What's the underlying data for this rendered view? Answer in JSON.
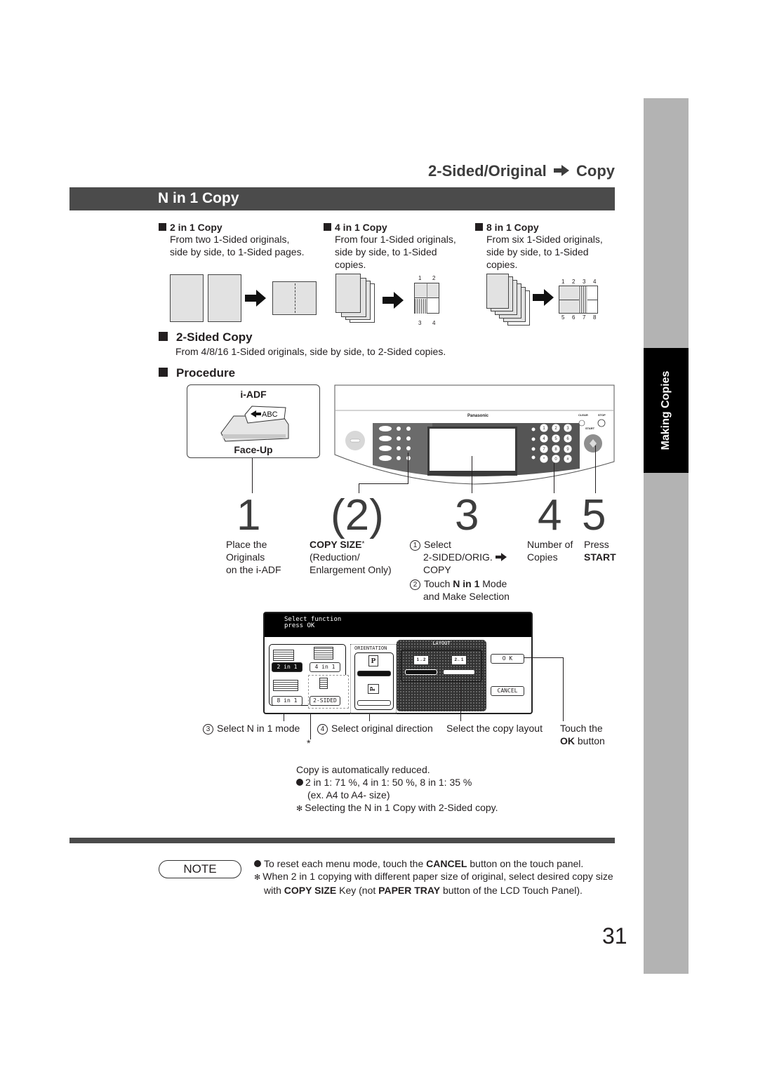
{
  "side_tab": {
    "label": "Making Copies"
  },
  "section_title": {
    "left": "2-Sided/Original",
    "arrow_icon": "right-arrow-icon",
    "right": "Copy"
  },
  "title_bar": {
    "text": "N in 1 Copy"
  },
  "modes": [
    {
      "heading": "2 in 1 Copy",
      "desc": [
        "From two 1-Sided originals,",
        "side by side, to 1-Sided pages."
      ]
    },
    {
      "heading": "4 in 1 Copy",
      "desc": [
        "From four 1-Sided originals,",
        "side by side, to 1-Sided",
        "copies."
      ],
      "page_labels": [
        "1",
        "2",
        "3",
        "4"
      ]
    },
    {
      "heading": "8 in 1 Copy",
      "desc": [
        "From six 1-Sided originals,",
        "side by side, to 1-Sided",
        "copies."
      ],
      "page_labels": [
        "1",
        "2",
        "3",
        "4",
        "5",
        "6",
        "7",
        "8"
      ]
    }
  ],
  "two_sided": {
    "heading": "2-Sided Copy",
    "desc": "From  4/8/16 1-Sided originals, side by side, to 2-Sided copies."
  },
  "procedure": {
    "heading": "Procedure",
    "adf": {
      "title": "i-ADF",
      "label": "ABC",
      "footer": "Face-Up"
    },
    "panel": {
      "brand": "Panasonic",
      "clear": "CLEAR",
      "stop": "STOP",
      "start": "START",
      "keys": [
        "1",
        "2",
        "3",
        "4",
        "5",
        "6",
        "7",
        "8",
        "9",
        "*",
        "0",
        "#"
      ]
    },
    "steps": [
      {
        "num": "1",
        "lines": [
          "Place the",
          "Originals",
          "on the i-ADF"
        ]
      },
      {
        "num": "(2)",
        "bold": "COPY SIZE",
        "star": "*",
        "lines": [
          "(Reduction/",
          "Enlargement Only)"
        ]
      },
      {
        "num": "3",
        "sub1": {
          "marker": "1",
          "lines": [
            "Select",
            "2-SIDED/ORIG.",
            "COPY"
          ]
        },
        "sub2": {
          "marker": "2",
          "pre": "Touch ",
          "bold": "N in 1",
          "post": " Mode",
          "line2": "and Make Selection"
        }
      },
      {
        "num": "4",
        "lines": [
          "Number of",
          "Copies"
        ]
      },
      {
        "num": "5",
        "lines": [
          "Press"
        ],
        "bold": "START"
      }
    ]
  },
  "lcd": {
    "header_lines": [
      "Select function",
      "press OK"
    ],
    "buttons": {
      "two_in_one": "2 in 1",
      "four_in_one": "4 in 1",
      "eight_in_one": "8 in 1",
      "two_sided": "2-SIDED",
      "ok": "O K",
      "cancel": "CANCEL"
    },
    "orientation_label": "ORIENTATION",
    "layout_label": "LAYOUT",
    "layout_icons": [
      "1→2",
      "2←1"
    ]
  },
  "callouts": {
    "c3": {
      "marker": "3",
      "text": "Select N in 1 mode"
    },
    "star": "*",
    "c4": {
      "marker": "4",
      "text": "Select original direction"
    },
    "layout": "Select the copy layout",
    "ok": {
      "line1": "Touch the",
      "bold": "OK",
      "post": " button"
    }
  },
  "reduction_note": {
    "line1": "Copy is automatically reduced.",
    "line2": "2 in 1: 71 %, 4 in 1: 50 %, 8 in 1: 35 %",
    "line3": "(ex. A4 to A4- size)",
    "line4": "Selecting the N in 1 Copy with 2-Sided copy."
  },
  "note": {
    "label": "NOTE",
    "item1": {
      "pre": "To reset each menu mode, touch the ",
      "bold": "CANCEL",
      "post": " button on the touch panel."
    },
    "item2": {
      "pre": "When 2 in 1 copying with different paper size of original, select desired copy size with ",
      "bold1": "COPY SIZE",
      "mid": " Key (not ",
      "bold2": "PAPER TRAY",
      "post": " button of the LCD Touch Panel)."
    }
  },
  "page_number": "31"
}
